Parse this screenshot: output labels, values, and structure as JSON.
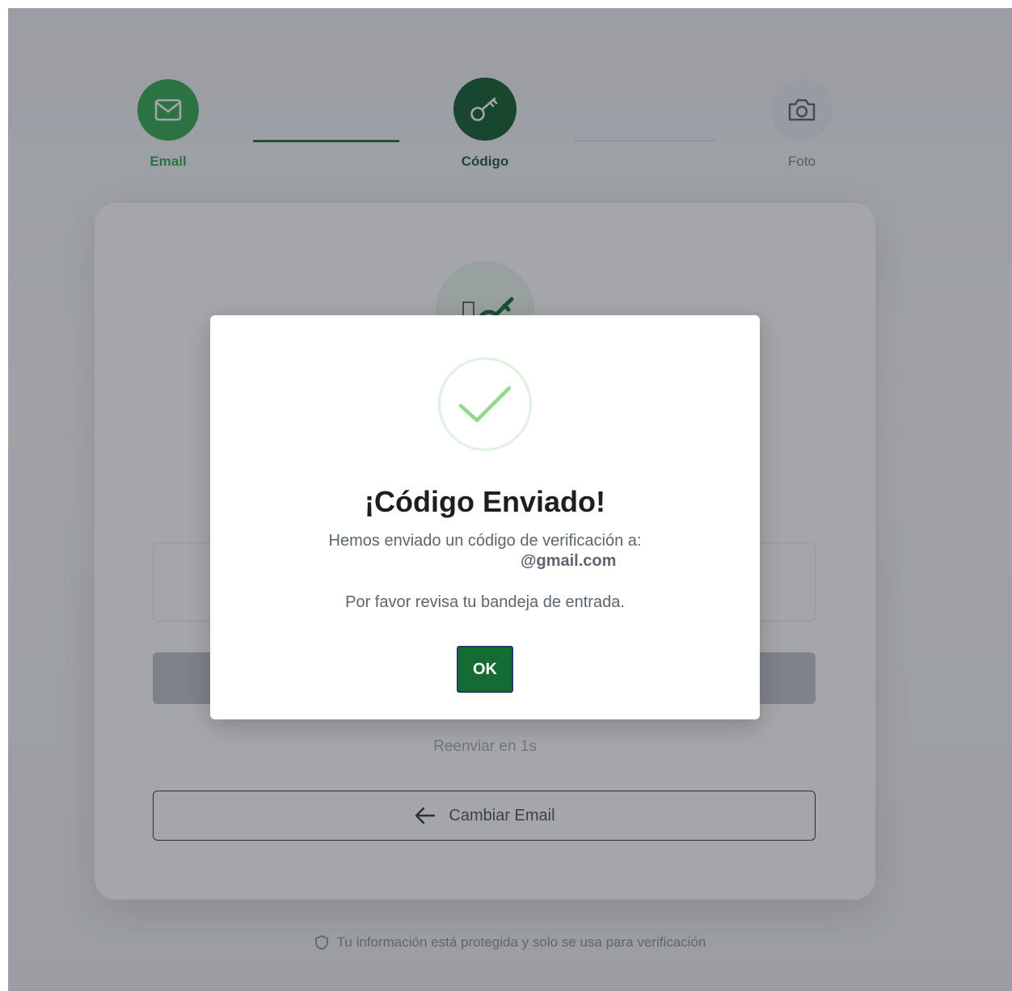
{
  "stepper": {
    "steps": [
      {
        "label": "Email",
        "icon": "mail-icon",
        "state": "completed"
      },
      {
        "label": "Código",
        "icon": "key-icon",
        "state": "active"
      },
      {
        "label": "Foto",
        "icon": "camera-icon",
        "state": "pending"
      }
    ]
  },
  "card": {
    "icon": "key-icon",
    "resend_label": "Reenviar en 1s",
    "change_email_label": "Cambiar Email"
  },
  "footer": {
    "note": "Tu información está protegida y solo se usa para verificación",
    "icon": "shield-icon"
  },
  "modal": {
    "icon": "check-icon",
    "title": "¡Código Enviado!",
    "message": "Hemos enviado un código de verificación a:",
    "email": "@gmail.com",
    "message2": "Por favor revisa tu bandeja de entrada.",
    "ok_label": "OK"
  },
  "colors": {
    "primary_green": "#146b34",
    "completed_green": "#2fa84f",
    "check_green": "#8fd88c",
    "overlay": "rgba(40,44,52,0.42)"
  }
}
